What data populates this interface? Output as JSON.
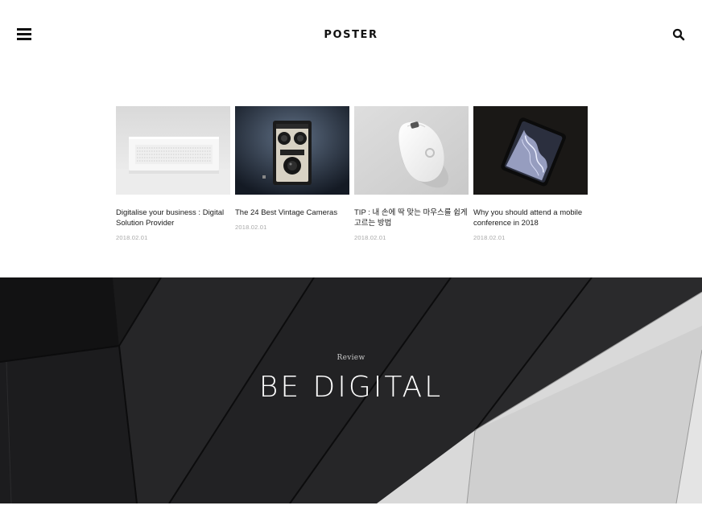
{
  "header": {
    "logo": "POSTER",
    "menu_icon": "hamburger-menu-icon",
    "search_icon": "search-icon"
  },
  "posts": [
    {
      "title": "Digitalise your business : Digital Solution Provider",
      "date": "2018.02.01",
      "image": "white-speaker-photo"
    },
    {
      "title": "The 24 Best Vintage Cameras",
      "date": "2018.02.01",
      "image": "vintage-camera-photo"
    },
    {
      "title": "TIP : 내 손에 딱 맞는 마우스를 쉽게 고르는 방법",
      "date": "2018.02.01",
      "image": "white-mouse-photo"
    },
    {
      "title": "Why you should attend a mobile conference in 2018",
      "date": "2018.02.01",
      "image": "smartphone-photo"
    }
  ],
  "banner": {
    "kicker": "Review",
    "headline": "BE DIGITAL",
    "image": "abstract-architecture-photo"
  },
  "colors": {
    "text": "#111111",
    "date": "#a8a8a8",
    "banner_dark": "#222222",
    "banner_light": "#dcdcdc"
  }
}
